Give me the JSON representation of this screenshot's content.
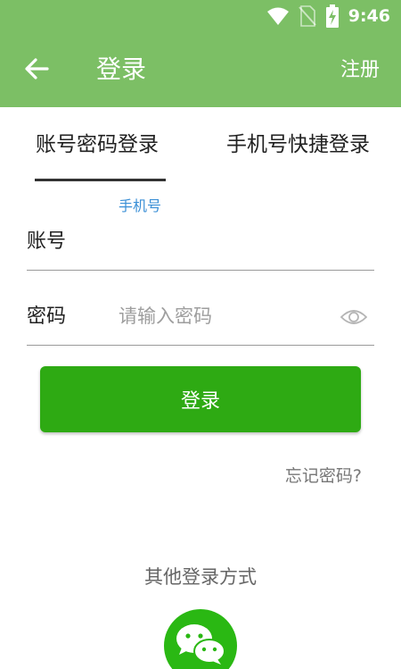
{
  "status_bar": {
    "time": "9:46",
    "icons": [
      "wifi-icon",
      "no-sim-icon",
      "battery-charging-icon"
    ]
  },
  "header": {
    "title": "登录",
    "register_label": "注册",
    "back_icon": "arrow-left-icon"
  },
  "tabs": [
    {
      "label": "账号密码登录",
      "active": true
    },
    {
      "label": "手机号快捷登录",
      "active": false
    }
  ],
  "form": {
    "account": {
      "hint": "手机号",
      "label": "账号",
      "value": "",
      "placeholder": ""
    },
    "password": {
      "label": "密码",
      "value": "",
      "placeholder": "请输入密码",
      "toggle_icon": "eye-icon"
    }
  },
  "login_button": "登录",
  "forgot_password": "忘记密码?",
  "other_login": {
    "title": "其他登录方式",
    "icons": [
      "wechat-icon"
    ]
  },
  "colors": {
    "header": "#7cbf65",
    "primary_button": "#2eaa13",
    "hint": "#3a8fd6",
    "wechat": "#2ab813"
  }
}
